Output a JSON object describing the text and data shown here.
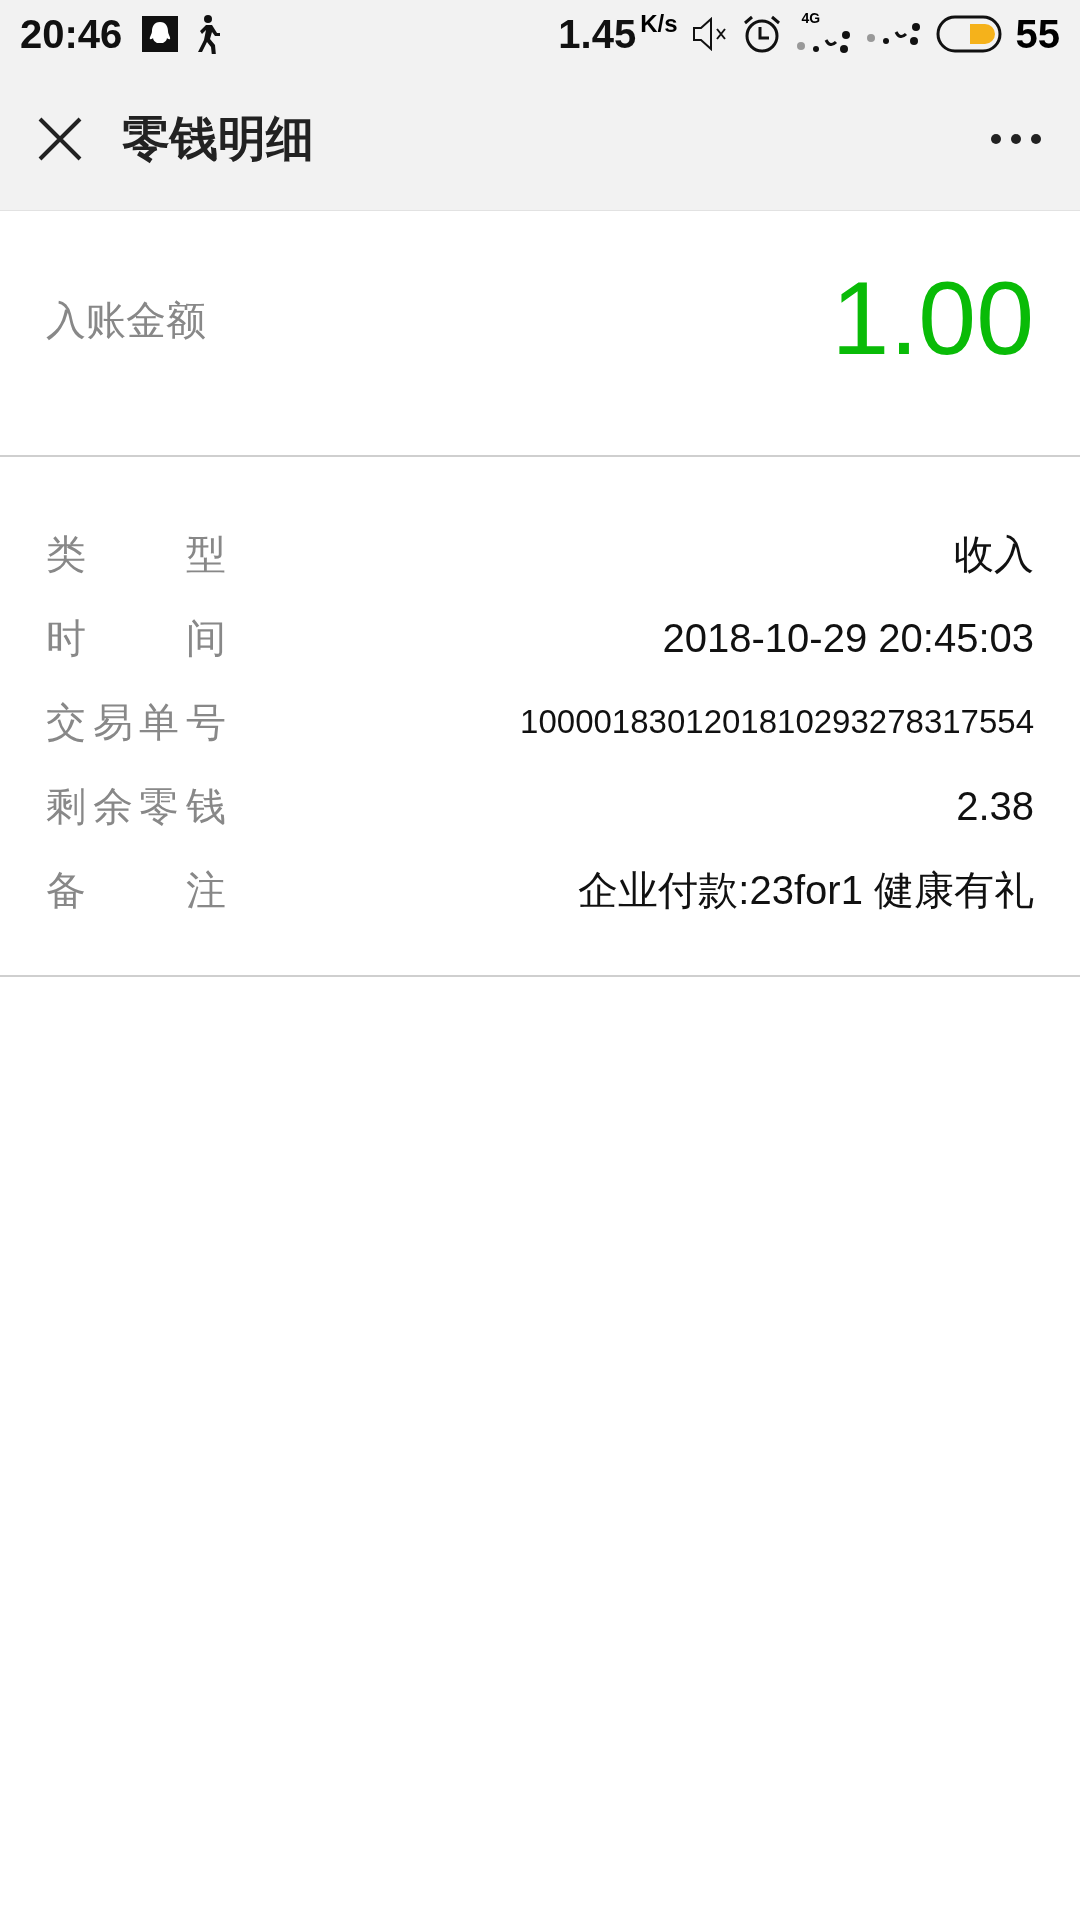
{
  "status_bar": {
    "time": "20:46",
    "speed": "1.45",
    "speed_unit": "K/s",
    "network": "4G",
    "battery": "55"
  },
  "nav": {
    "title": "零钱明细"
  },
  "amount": {
    "label": "入账金额",
    "value": "1.00"
  },
  "details": [
    {
      "label": "类型",
      "value": "收入"
    },
    {
      "label": "时间",
      "value": "2018-10-29 20:45:03"
    },
    {
      "label": "交易单号",
      "value": "1000018301201810293278317554"
    },
    {
      "label": "剩余零钱",
      "value": "2.38"
    },
    {
      "label": "备注",
      "value": "企业付款:23for1 健康有礼"
    }
  ]
}
